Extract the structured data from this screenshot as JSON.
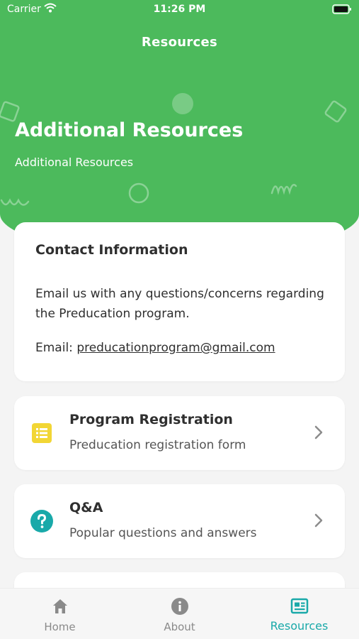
{
  "status_bar": {
    "carrier": "Carrier",
    "time": "11:26 PM"
  },
  "nav": {
    "title": "Resources"
  },
  "hero": {
    "title": "Additional Resources",
    "subtitle": "Additional Resources"
  },
  "contact": {
    "heading": "Contact Information",
    "body": "Email us with any questions/concerns regarding the Preducation program.",
    "email_label": "Email:",
    "email": "preducationprogram@gmail.com"
  },
  "resources": [
    {
      "title": "Program Registration",
      "subtitle": "Preducation registration form",
      "icon": "list-icon",
      "color": "#f2d635"
    },
    {
      "title": "Q&A",
      "subtitle": "Popular questions and answers",
      "icon": "question-icon",
      "color": "#19a9a9"
    }
  ],
  "tabs": [
    {
      "label": "Home",
      "icon": "home-icon"
    },
    {
      "label": "About",
      "icon": "info-icon"
    },
    {
      "label": "Resources",
      "icon": "news-icon",
      "active": true
    }
  ],
  "colors": {
    "brand_green": "#4cba5c",
    "accent_teal": "#1aa9a9",
    "background": "#f4f4f4"
  }
}
